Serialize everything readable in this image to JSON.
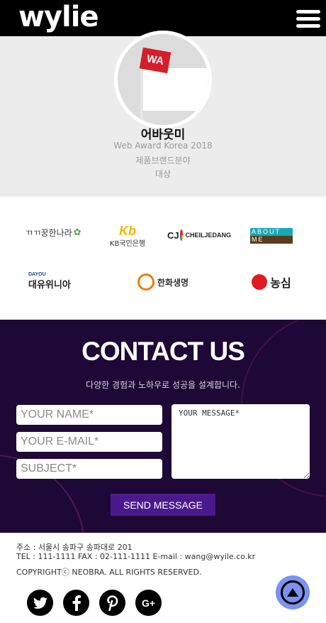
{
  "header": {
    "logo": "wylie",
    "menu_icon": "hamburger-menu-icon"
  },
  "award": {
    "flag_text": "WA",
    "title": "어바웃미",
    "lines": [
      "Web Award Korea 2018",
      "제품브랜드분야",
      "대상"
    ]
  },
  "clients": [
    {
      "name": "까꿍한나라",
      "label": "ㄲㄲ꿍한나라"
    },
    {
      "name": "KB국민은행",
      "label": "KB국민은행",
      "mark": "Kb"
    },
    {
      "name": "CJ CHEILJEDANG",
      "label": "CHEILJEDANG",
      "mark": "CJ"
    },
    {
      "name": "ABOUT ME",
      "label_top": "ABOUT",
      "label_bottom": "ME"
    },
    {
      "name": "대유위니아",
      "label_top": "DAYOU",
      "label": "대유위니아"
    },
    {
      "name": "한화생명",
      "label": "한화생명"
    },
    {
      "name": "농심",
      "label": "농심"
    }
  ],
  "contact": {
    "title": "CONTACT US",
    "subtitle": "다양한 경험과 노하우로 성공을 설계합니다.",
    "name_placeholder": "YOUR NAME*",
    "email_placeholder": "YOUR E-MAIL*",
    "subject_placeholder": "SUBJECT*",
    "message_placeholder": "YOUR MESSAGE*",
    "send_label": "SEND MESSAGE"
  },
  "footer": {
    "address": "주소 : 서울시 송파구 송파대로 201",
    "contact_line": "TEL : 111-1111 FAX : 02-111-1111 E-mail : wang@wyile.co.kr",
    "copyright": "COPYRIGHTⓒ NEOBRA. ALL RIGHTS RESERVED.",
    "social": [
      "twitter-icon",
      "facebook-icon",
      "pinterest-icon",
      "google-plus-icon"
    ],
    "google_plus_text": "G+",
    "to_top_icon": "arrow-up-icon"
  }
}
